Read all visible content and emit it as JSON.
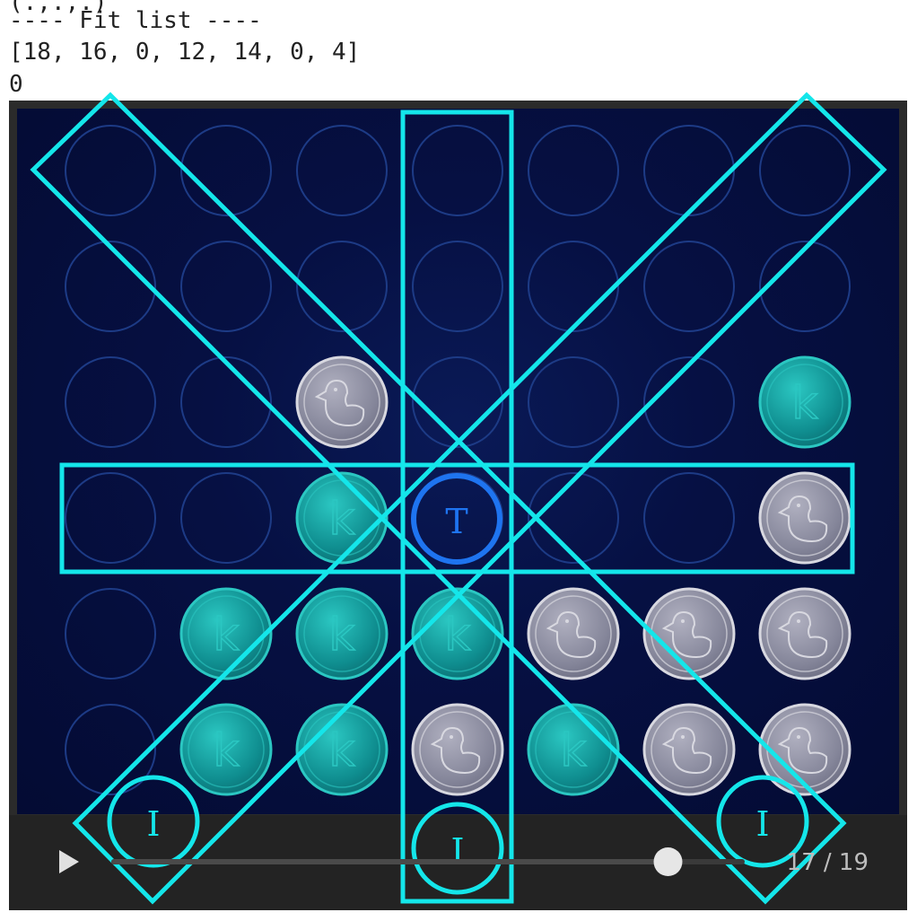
{
  "console": {
    "lines": [
      "(.,.,.)",
      "---- Fit list ----",
      "[18, 16, 0, 12, 14, 0, 4]",
      "0"
    ]
  },
  "board": {
    "rows": 6,
    "cols": 7,
    "grid": [
      [
        ".",
        ".",
        ".",
        ".",
        ".",
        ".",
        "."
      ],
      [
        ".",
        ".",
        ".",
        ".",
        ".",
        ".",
        "."
      ],
      [
        ".",
        ".",
        "D",
        ".",
        ".",
        ".",
        "K"
      ],
      [
        ".",
        ".",
        "K",
        "T",
        ".",
        ".",
        "D"
      ],
      [
        ".",
        "K",
        "K",
        "K",
        "D",
        "D",
        "D"
      ],
      [
        ".",
        "K",
        "K",
        "D",
        "K",
        "D",
        "D"
      ]
    ],
    "glyph_k": "k",
    "colors": {
      "empty_ring": "#1d3b86",
      "teal_piece": "#0f8d8f",
      "teal_light": "#2bc7c2",
      "grey_piece": "#85869a",
      "grey_light": "#d8d8e0",
      "highlight": "#14e6ea",
      "target_ring": "#1e74f0"
    }
  },
  "annotations": {
    "target_label": "T",
    "marker_label": "I"
  },
  "player": {
    "play_icon": "play-icon",
    "step_counter": "17 / 19",
    "progress": 0.85
  }
}
